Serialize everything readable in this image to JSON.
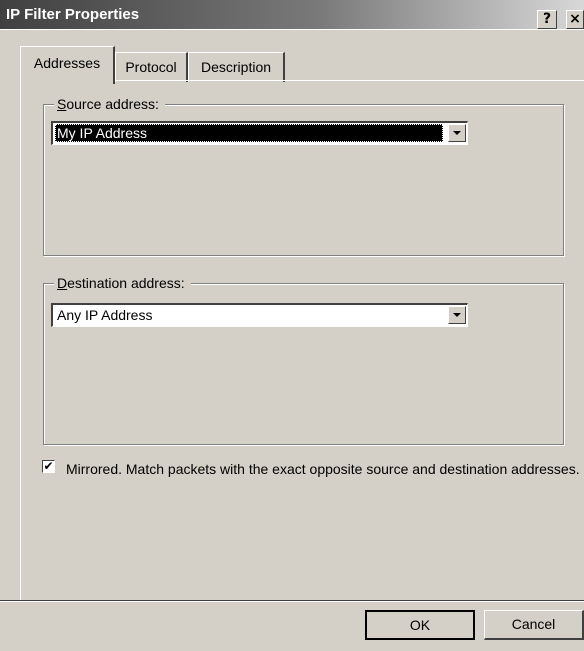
{
  "window": {
    "title": "IP Filter Properties",
    "help_glyph": "?",
    "close_glyph": "×"
  },
  "tabs": [
    {
      "label": "Addresses",
      "active": true
    },
    {
      "label": "Protocol",
      "active": false
    },
    {
      "label": "Description",
      "active": false
    }
  ],
  "source": {
    "label_mnemonic": "S",
    "label_rest": "ource address:",
    "selected_value": "My IP Address"
  },
  "destination": {
    "label_mnemonic": "D",
    "label_rest": "estination address:",
    "selected_value": "Any IP Address"
  },
  "mirrored": {
    "checked": true,
    "check_glyph": "✔",
    "label": "Mirrored. Match packets with the exact opposite source and destination addresses."
  },
  "buttons": {
    "ok": "OK",
    "cancel": "Cancel"
  }
}
